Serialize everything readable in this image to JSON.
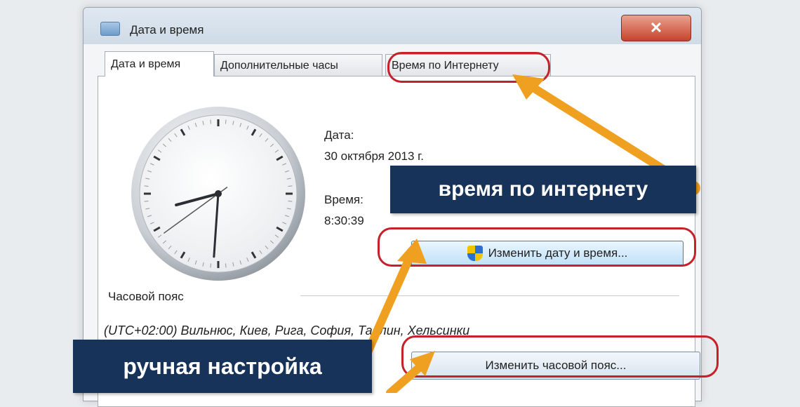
{
  "window": {
    "title": "Дата и время",
    "close_label": "✕"
  },
  "tabs": [
    {
      "label": "Дата и время"
    },
    {
      "label": "Дополнительные часы"
    },
    {
      "label": "Время по Интернету"
    }
  ],
  "date_section": {
    "date_label": "Дата:",
    "date_value": "30 октября 2013 г.",
    "time_label": "Время:",
    "time_value": "8:30:39"
  },
  "change_datetime_button": "Изменить дату и время...",
  "timezone_section": {
    "heading": "Часовой пояс",
    "value": "(UTC+02:00) Вильнюс, Киев, Рига, София, Таллин, Хельсинки"
  },
  "change_timezone_button": "Изменить часовой пояс...",
  "annotations": {
    "internet_time_banner": "время по интернету",
    "manual_setup_banner": "ручная настройка",
    "arrow_color": "#f0a020",
    "highlight_color": "#c6202a",
    "banner_color": "#18335a"
  },
  "clock_time": {
    "hours": 8,
    "minutes": 30,
    "seconds": 39
  }
}
